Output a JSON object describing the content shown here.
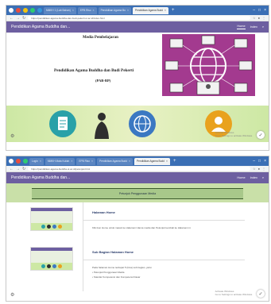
{
  "top": {
    "tabs": [
      {
        "label": "MMKH 1 (Lab Bahan)",
        "active": false
      },
      {
        "label": "EPB Riso",
        "active": false
      },
      {
        "label": "Pendidikan Agama Bu",
        "active": false
      },
      {
        "label": "Pendidikan Agama Budd",
        "active": true
      }
    ],
    "url": "https://pendidikan-agama-buddha-dan-budi-pekerti.ut.ac.id/index.html",
    "site_title": "Pendidikan Agama Buddha dan...",
    "menu": [
      "Home",
      "Index"
    ],
    "slide": {
      "heading": "Media Pembelajaran",
      "title_line1": "Pendidikan Agama Buddha dan Budi Pekerti",
      "title_line2": "(PAB-BP)"
    },
    "circle_icons": [
      {
        "name": "document-icon",
        "color": "#29a1a8"
      },
      {
        "name": "buddha-icon",
        "color": "#2f2f2f"
      },
      {
        "name": "globe-icon",
        "color": "#3b78c2"
      },
      {
        "name": "user-icon",
        "color": "#e9a21d"
      }
    ],
    "activate": [
      "Activate Windows",
      "Go to Settings to activate Windows."
    ]
  },
  "bottom": {
    "tabs": [
      {
        "label": "Login",
        "active": false
      },
      {
        "label": "MMKH Mata Kuliah",
        "active": false
      },
      {
        "label": "EPB Riso",
        "active": false
      },
      {
        "label": "Pendidikan Agama Budd",
        "active": false
      },
      {
        "label": "Pendidikan Agama Budd",
        "active": true
      }
    ],
    "url": "https://pendidikan-agama-buddha.ut.ac.id/petunjuk.html",
    "site_title": "Pendidikan Agama Buddha dan...",
    "menu": [
      "Home",
      "Index"
    ],
    "section_title": "Petunjuk Penggunaan Media",
    "items": [
      {
        "heading": "Halaman Home",
        "text": "Klik ikon Home untuk masuk ke Halaman Utama media dan Petunjuk kembali ke Halaman ini."
      },
      {
        "heading": "Sub Bagian Halaman Home",
        "text": "Pada halaman Home terdapat 5 (lima) sub bagian, yaitu:",
        "bullets": [
          "Petunjuk Penggunaan Media",
          "Standar Kompetensi dan Kompetensi Dasar"
        ]
      }
    ],
    "activate": [
      "Activate Windows",
      "Go to Settings to activate Windows."
    ]
  },
  "colors": {
    "taskbar": "#3b6fb5",
    "sitebar": "#6d5fa0",
    "green_band": "#cde8a4",
    "globe_panel": "#a33a8f"
  }
}
